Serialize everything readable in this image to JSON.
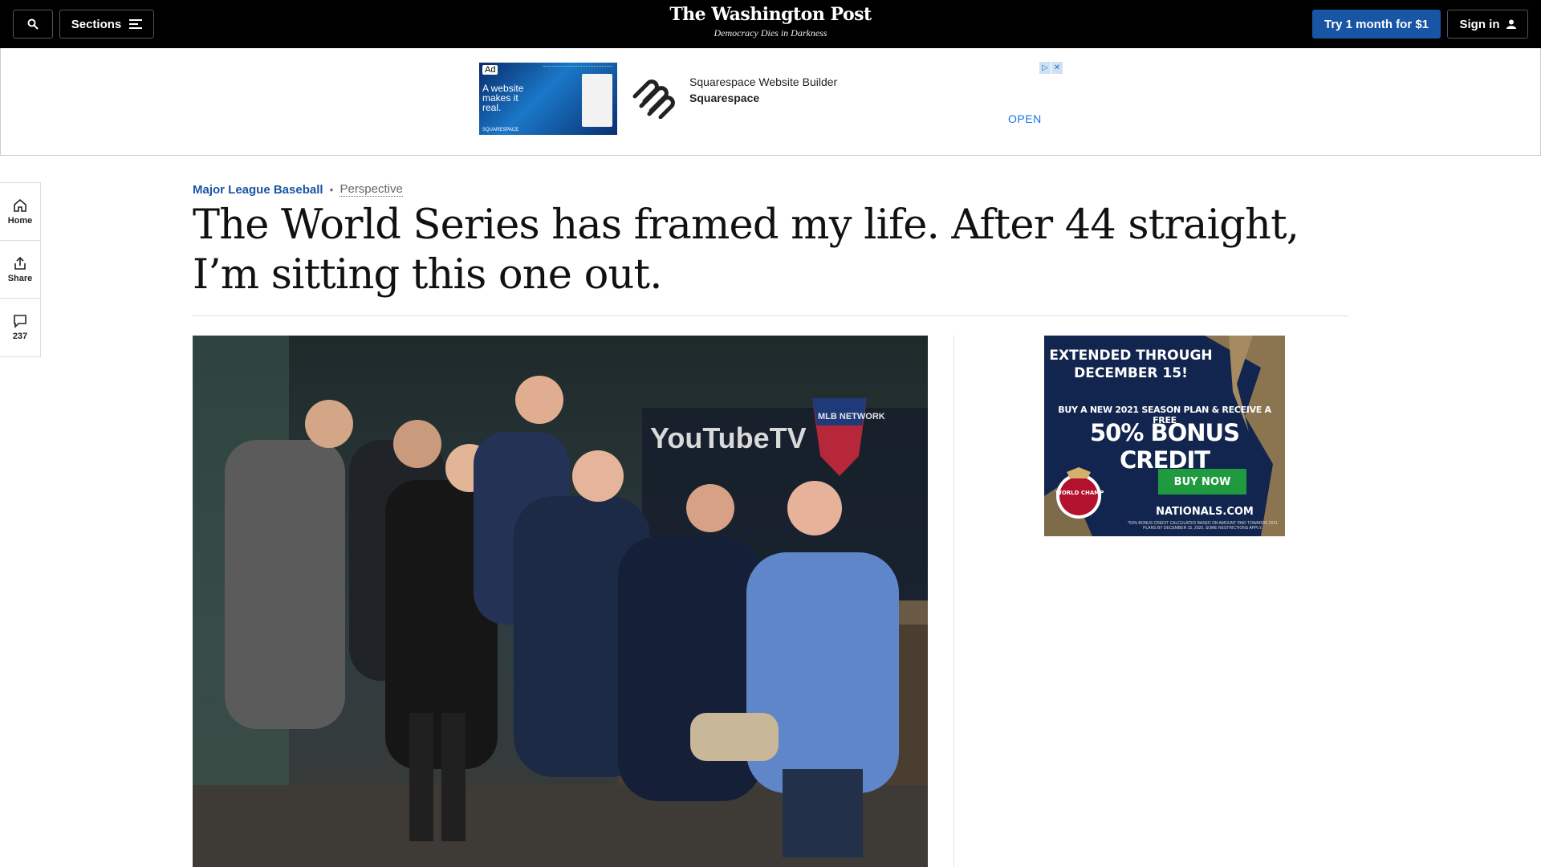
{
  "header": {
    "sections_label": "Sections",
    "logo": "The Washington Post",
    "tagline": "Democracy Dies in Darkness",
    "trial_label": "Try 1 month for $1",
    "signin_label": "Sign in"
  },
  "top_ad": {
    "ad_tag": "Ad",
    "creative_text": "A website makes it real.",
    "creative_brand": "SQUARESPACE",
    "headline": "Squarespace Website Builder",
    "advertiser": "Squarespace",
    "cta": "OPEN"
  },
  "rail": {
    "home_label": "Home",
    "share_label": "Share",
    "comments_count": "237"
  },
  "article": {
    "section": "Major League Baseball",
    "label": "Perspective",
    "headline": "The World Series has framed my life. After 44 straight, I’m sitting this one out."
  },
  "photo": {
    "wall_brand": "YouTubeTV",
    "network_logo": "MLB NETWORK"
  },
  "side_ad": {
    "line1": "EXTENDED THROUGH DECEMBER 15!",
    "line2": "BUY A NEW 2021 SEASON PLAN & RECEIVE A FREE",
    "line3": "50% BONUS CREDIT",
    "cta": "BUY NOW",
    "site": "NATIONALS.COM",
    "fine_print": "*50% BONUS CREDIT CALCULATED BASED ON AMOUNT PAID TOWARDS 2021 PLANS BY DECEMBER 15, 2020. SOME RESTRICTIONS APPLY.",
    "badge_text": "2019 WORLD CHAMPIONS"
  },
  "colors": {
    "brand_blue": "#1955a5",
    "topbar": "#000000",
    "ad_blue": "#1a73e8",
    "nats_navy": "#12254f",
    "buy_green": "#1f9a3f"
  }
}
